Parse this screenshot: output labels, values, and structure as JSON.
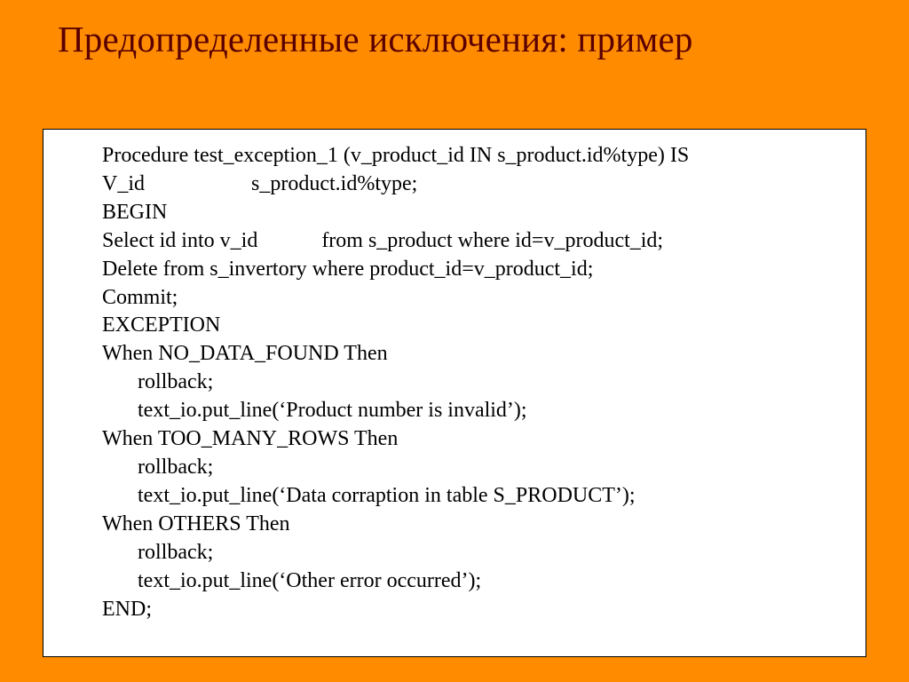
{
  "slide": {
    "title": "Предопределенные исключения: пример",
    "code": {
      "l1": "Procedure test_exception_1 (v_product_id IN s_product.id%type) IS",
      "l2": "V_id                    s_product.id%type;",
      "l3": "BEGIN",
      "l4": "Select id into v_id            from s_product where id=v_product_id;",
      "l5": "Delete from s_invertory where product_id=v_product_id;",
      "l6": "Commit;",
      "l7": "EXCEPTION",
      "l8": "When NO_DATA_FOUND Then",
      "l9": "rollback;",
      "l10": "text_io.put_line(‘Product number is invalid’);",
      "l11": "When TOO_MANY_ROWS Then",
      "l12": "rollback;",
      "l13": "text_io.put_line(‘Data corraption in table S_PRODUCT’);",
      "l14": "When OTHERS Then",
      "l15": "rollback;",
      "l16": "text_io.put_line(‘Other error occurred’);",
      "l17": "END;"
    }
  }
}
